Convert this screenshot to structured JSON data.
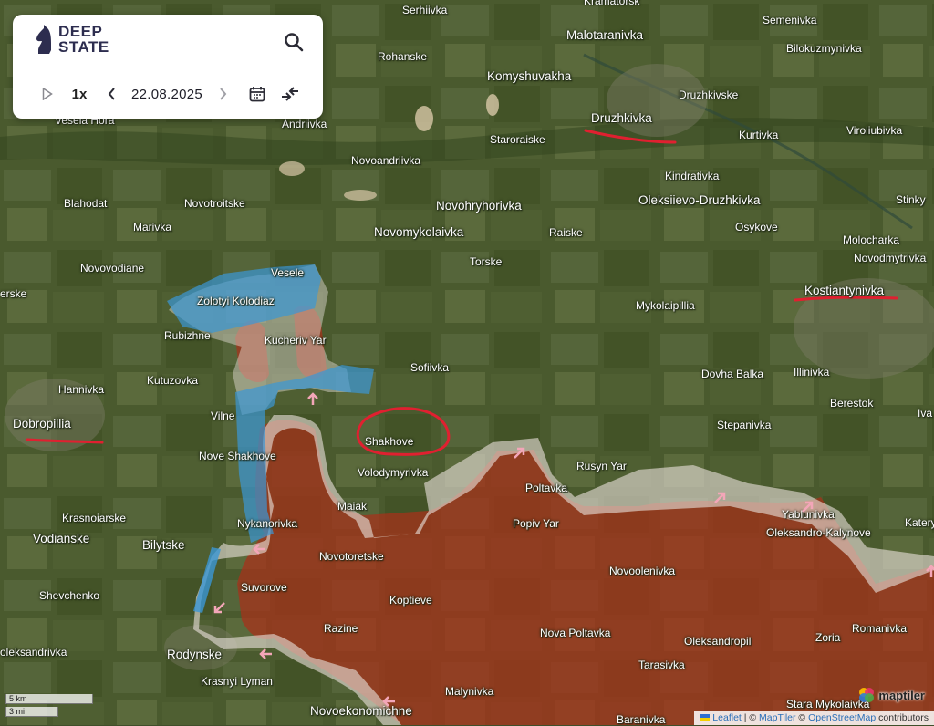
{
  "app": {
    "name_line1": "DEEP",
    "name_line2": "STATE"
  },
  "controls": {
    "speed": "1x",
    "date": "22.08.2025"
  },
  "colors": {
    "occupied": "#b0301a",
    "contested": "#e9e2dc",
    "liberated": "#3a9ad8",
    "highlight": "#e02030"
  },
  "icons": [
    "play-icon",
    "chevron-left-icon",
    "chevron-right-icon",
    "calendar-icon",
    "compare-icon",
    "search-icon"
  ],
  "map_labels": {
    "serhiivka": "Serhiivka",
    "kramatorsk": "Kramatorsk",
    "semenivka": "Semenivka",
    "malotaranivka": "Malotaranivka",
    "bilokuzmynivka": "Bilokuzmynivka",
    "rohanske": "Rohanske",
    "komyshuvakha": "Komyshuvakha",
    "druzhkivske": "Druzhkivske",
    "druzhkivka": "Druzhkivka",
    "veseliahora": "Vesela Hora",
    "andriivka": "Andriivka",
    "staroraiske": "Staroraiske",
    "kurtivka": "Kurtivka",
    "viroliubivka": "Viroliubivka",
    "novoandriivka": "Novoandriivka",
    "kindrativka": "Kindrativka",
    "blahodat": "Blahodat",
    "novotroitske": "Novotroitske",
    "novohryhorivka": "Novohryhorivka",
    "oleksiievo": "Oleksiievo-Druzhkivka",
    "stinky": "Stinky",
    "marivka": "Marivka",
    "novomykolaivka": "Novomykolaivka",
    "raiske": "Raiske",
    "osykove": "Osykove",
    "molocharka": "Molocharka",
    "novodmytrivka": "Novodmytrivka",
    "novovodiane": "Novovodiane",
    "torske": "Torske",
    "vesele": "Vesele",
    "zolotyi": "Zolotyi Kolodiaz",
    "kostiantynivka": "Kostiantynivka",
    "erske": "erske",
    "mykolaipillia": "Mykolaipillia",
    "rubizhne": "Rubizhne",
    "kucheriv": "Kucheriv Yar",
    "sofiivka": "Sofiivka",
    "dovhabalka": "Dovha Balka",
    "illinivka": "Illinivka",
    "kutuzovka": "Kutuzovka",
    "hannivka": "Hannivka",
    "berestok": "Berestok",
    "dobropillia": "Dobropillia",
    "vilne": "Vilne",
    "stepanivka": "Stepanivka",
    "iva": "Iva",
    "shakhove": "Shakhove",
    "noveshakhove": "Nove Shakhove",
    "rusynyar": "Rusyn Yar",
    "volodymyrivka": "Volodymyrivka",
    "poltavka": "Poltavka",
    "maiak": "Maiak",
    "krasnoiarske": "Krasnoiarske",
    "popivyar": "Popiv Yar",
    "yablunivka": "Yablunivka",
    "katery": "Katery",
    "vodianske": "Vodianske",
    "nykanorivka": "Nykanorivka",
    "bilytske": "Bilytske",
    "oleksandrokalynove": "Oleksandro-Kalynove",
    "novotoretske": "Novotoretske",
    "novoolenivka": "Novoolenivka",
    "suvorove": "Suvorove",
    "shevchenko": "Shevchenko",
    "koptieve": "Koptieve",
    "razine": "Razine",
    "novapoltavka": "Nova Poltavka",
    "romanivka": "Romanivka",
    "oleksandrivka": "oleksandrivka",
    "rodynske": "Rodynske",
    "oleksandropil": "Oleksandropil",
    "zoria": "Zoria",
    "tarasivka": "Tarasivka",
    "krasnyilyman": "Krasnyi Lyman",
    "malynivka": "Malynivka",
    "novoekonomichne": "Novoekonomichne",
    "staramykolaivka": "Stara Mykolaivka",
    "baranivka": "Baranivka"
  },
  "scale": {
    "km": "5 km",
    "mi": "3 mi"
  },
  "brand": {
    "maptiler": "maptiler"
  },
  "attribution": {
    "leaflet": "Leaflet",
    "sep1": " | © ",
    "maptiler": "MapTiler",
    "sep2": " © ",
    "osm": "OpenStreetMap",
    "suffix": " contributors"
  }
}
